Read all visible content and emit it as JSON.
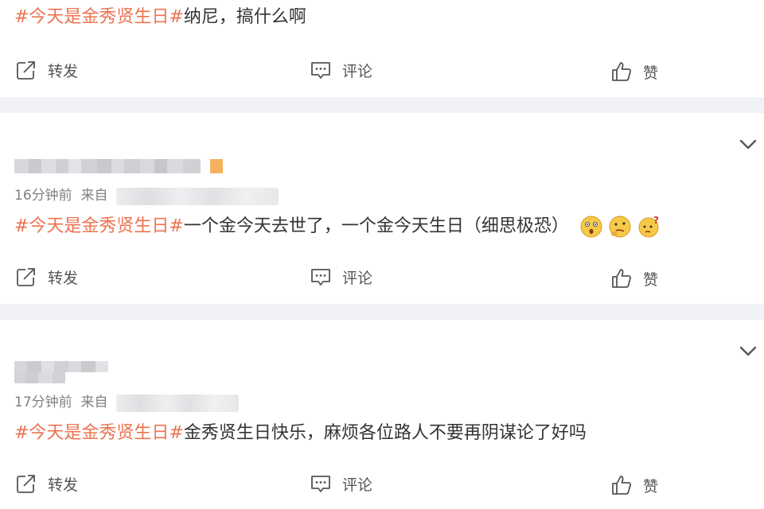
{
  "posts": [
    {
      "hashtag": "#今天是金秀贤生日#",
      "text": "纳尼，搞什么啊"
    },
    {
      "time": "16分钟前",
      "source_prefix": "来自",
      "hashtag": "#今天是金秀贤生日#",
      "text": "一个金今天去世了，一个金今天生日（细思极恐）",
      "emojis": [
        "shock-face-icon",
        "thinking-face-icon",
        "question-face-icon"
      ]
    },
    {
      "time": "17分钟前",
      "source_prefix": "来自",
      "hashtag": "#今天是金秀贤生日#",
      "text": "金秀贤生日快乐，麻烦各位路人不要再阴谋论了好吗"
    }
  ],
  "actions": {
    "repost": "转发",
    "comment": "评论",
    "like": "赞"
  },
  "colors": {
    "hashtag": "#eb7350",
    "background": "#f1f2f5",
    "card": "#ffffff",
    "meta": "#808080"
  }
}
